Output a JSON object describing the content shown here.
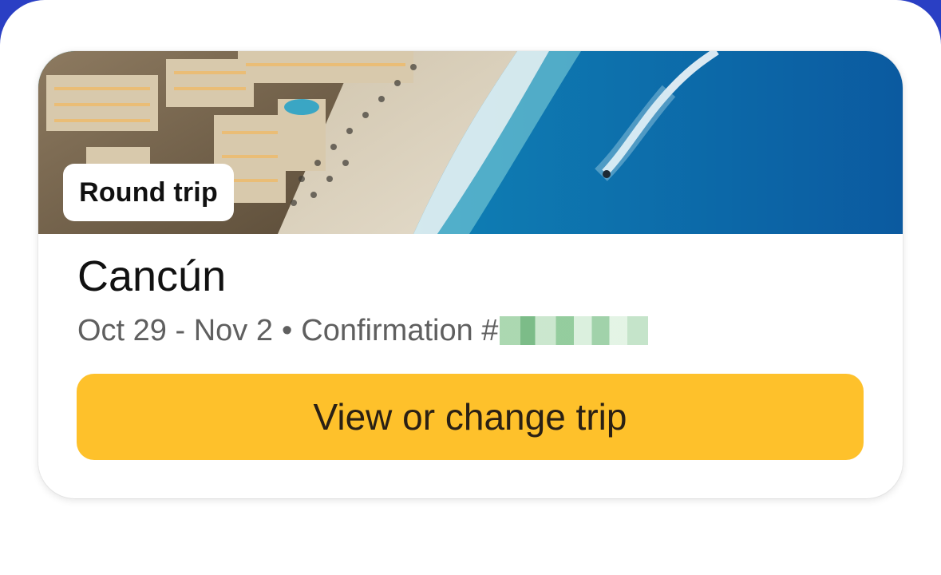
{
  "trip_card": {
    "trip_type_badge": "Round trip",
    "destination": "Cancún",
    "dates": "Oct 29 - Nov 2",
    "separator": "•",
    "confirmation_label": "Confirmation #",
    "cta_label": "View or change trip",
    "hero_image": "aerial-beach-resort-photo"
  },
  "colors": {
    "cta_background": "#fec12b",
    "background_accent": "#2a3fc4",
    "redaction": "#8fca99"
  }
}
